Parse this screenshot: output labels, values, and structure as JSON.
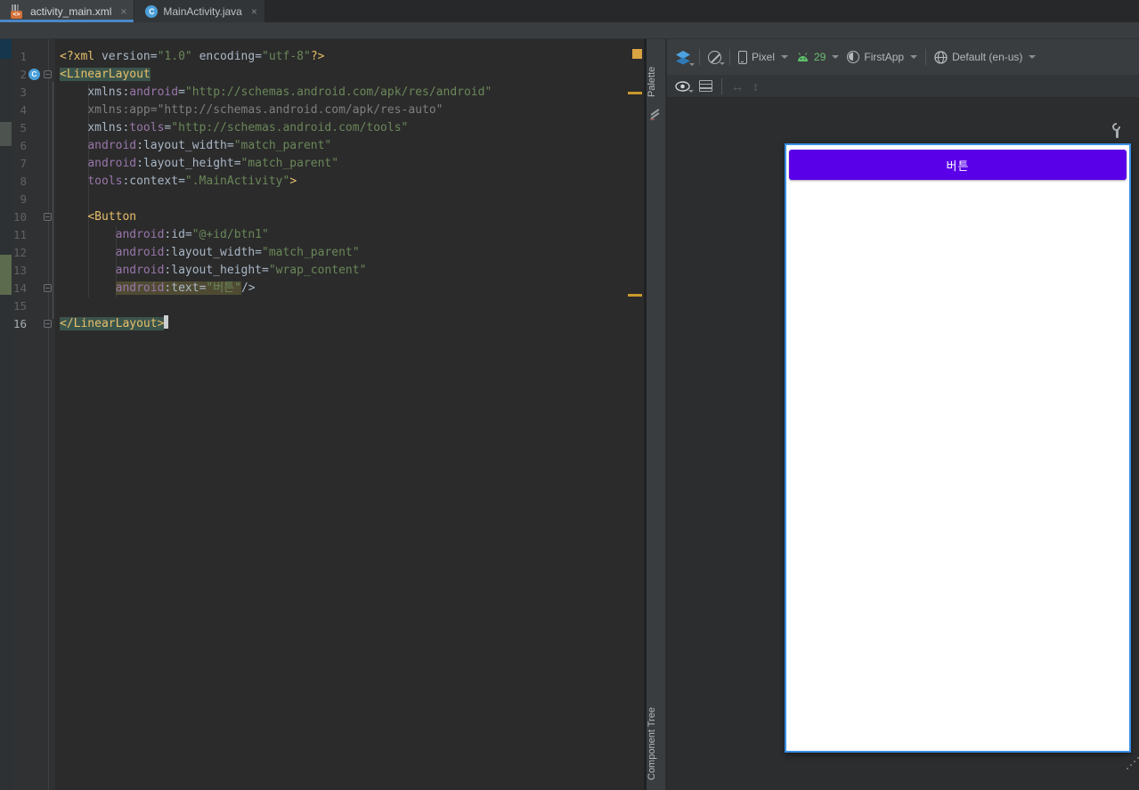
{
  "tabs": {
    "close_glyph": "×",
    "items": [
      {
        "label": "activity_main.xml",
        "icon": "android-xml-file-icon",
        "active": true
      },
      {
        "label": "MainActivity.java",
        "icon": "java-class-icon",
        "active": false
      }
    ]
  },
  "editor": {
    "language": "xml",
    "gutter_class_badge": "C",
    "lines": [
      {
        "n": "1",
        "segs": [
          [
            "tag",
            "<?xml "
          ],
          [
            "attr",
            "version"
          ],
          [
            "plain",
            "="
          ],
          [
            "val",
            "\"1.0\""
          ],
          [
            "plain",
            " "
          ],
          [
            "attr",
            "encoding"
          ],
          [
            "plain",
            "="
          ],
          [
            "val",
            "\"utf-8\""
          ],
          [
            "tag",
            "?>"
          ]
        ]
      },
      {
        "n": "2",
        "badge": true,
        "fold": "open",
        "segs": [
          [
            "tag",
            "<LinearLayout",
            "t"
          ]
        ]
      },
      {
        "n": "3",
        "segs": [
          [
            "plain",
            "    "
          ],
          [
            "attr",
            "xmlns"
          ],
          [
            "plain",
            ":"
          ],
          [
            "ns",
            "android"
          ],
          [
            "plain",
            "="
          ],
          [
            "val",
            "\"http://schemas.android.com/apk/res/android\""
          ]
        ]
      },
      {
        "n": "4",
        "segs": [
          [
            "plain",
            "    "
          ],
          [
            "dim",
            "xmlns:app=\"http://schemas.android.com/apk/res-auto\""
          ]
        ]
      },
      {
        "n": "5",
        "segs": [
          [
            "plain",
            "    "
          ],
          [
            "attr",
            "xmlns"
          ],
          [
            "plain",
            ":"
          ],
          [
            "ns",
            "tools"
          ],
          [
            "plain",
            "="
          ],
          [
            "val",
            "\"http://schemas.android.com/tools\""
          ]
        ]
      },
      {
        "n": "6",
        "segs": [
          [
            "plain",
            "    "
          ],
          [
            "ns",
            "android"
          ],
          [
            "plain",
            ":"
          ],
          [
            "attr",
            "layout_width"
          ],
          [
            "plain",
            "="
          ],
          [
            "val",
            "\"match_parent\""
          ]
        ]
      },
      {
        "n": "7",
        "segs": [
          [
            "plain",
            "    "
          ],
          [
            "ns",
            "android"
          ],
          [
            "plain",
            ":"
          ],
          [
            "attr",
            "layout_height"
          ],
          [
            "plain",
            "="
          ],
          [
            "val",
            "\"match_parent\""
          ]
        ]
      },
      {
        "n": "8",
        "segs": [
          [
            "plain",
            "    "
          ],
          [
            "ns",
            "tools"
          ],
          [
            "plain",
            ":"
          ],
          [
            "attr",
            "context"
          ],
          [
            "plain",
            "="
          ],
          [
            "val",
            "\".MainActivity\""
          ],
          [
            "tag",
            ">"
          ]
        ]
      },
      {
        "n": "9",
        "segs": []
      },
      {
        "n": "10",
        "fold": "open",
        "segs": [
          [
            "plain",
            "    "
          ],
          [
            "tag",
            "<Button"
          ]
        ]
      },
      {
        "n": "11",
        "segs": [
          [
            "plain",
            "        "
          ],
          [
            "ns",
            "android"
          ],
          [
            "plain",
            ":"
          ],
          [
            "attr",
            "id"
          ],
          [
            "plain",
            "="
          ],
          [
            "val",
            "\"@+id/btn1\""
          ]
        ]
      },
      {
        "n": "12",
        "segs": [
          [
            "plain",
            "        "
          ],
          [
            "ns",
            "android"
          ],
          [
            "plain",
            ":"
          ],
          [
            "attr",
            "layout_width"
          ],
          [
            "plain",
            "="
          ],
          [
            "val",
            "\"match_parent\""
          ]
        ]
      },
      {
        "n": "13",
        "segs": [
          [
            "plain",
            "        "
          ],
          [
            "ns",
            "android"
          ],
          [
            "plain",
            ":"
          ],
          [
            "attr",
            "layout_height"
          ],
          [
            "plain",
            "="
          ],
          [
            "val",
            "\"wrap_content\""
          ]
        ]
      },
      {
        "n": "14",
        "fold": "end",
        "segs": [
          [
            "plain",
            "        "
          ],
          [
            "ns",
            "android",
            "o"
          ],
          [
            "plain",
            ":",
            "o"
          ],
          [
            "attr",
            "text",
            "o"
          ],
          [
            "plain",
            "=",
            "o"
          ],
          [
            "val",
            "\"버튼\"",
            "o"
          ],
          [
            "plain",
            "/>"
          ]
        ]
      },
      {
        "n": "15",
        "segs": []
      },
      {
        "n": "16",
        "fold": "end",
        "caret": true,
        "segs": [
          [
            "tag",
            "</LinearLayout>",
            "t"
          ]
        ]
      }
    ],
    "scrollbar": {
      "file_status_color": "#d9a343",
      "warning_marks_at_lines": [
        4,
        14
      ]
    }
  },
  "design": {
    "palette_label": "Palette",
    "component_tree_label": "Component Tree",
    "toolbar": {
      "device_label": "Pixel",
      "api_label": "29",
      "theme_label": "FirstApp",
      "locale_label": "Default (en-us)"
    },
    "toolbar2": {
      "h_arrow": "↔",
      "v_arrow": "↕"
    },
    "preview": {
      "button_label": "버튼"
    }
  },
  "colors": {
    "tab_underline": "#4a88c7",
    "editor_bg": "#2b2b2b",
    "button_purple": "#5a00e8",
    "frame_border_blue": "#3a8fe8",
    "warning_yellow": "#d9a343",
    "api_green": "#6abf73",
    "tag_yellow": "#e8bf6a",
    "value_green": "#6a8759",
    "namespace_purple": "#9876aa",
    "tag_match_highlight": "#3b544b",
    "write_access_highlight": "#4f4b33"
  }
}
